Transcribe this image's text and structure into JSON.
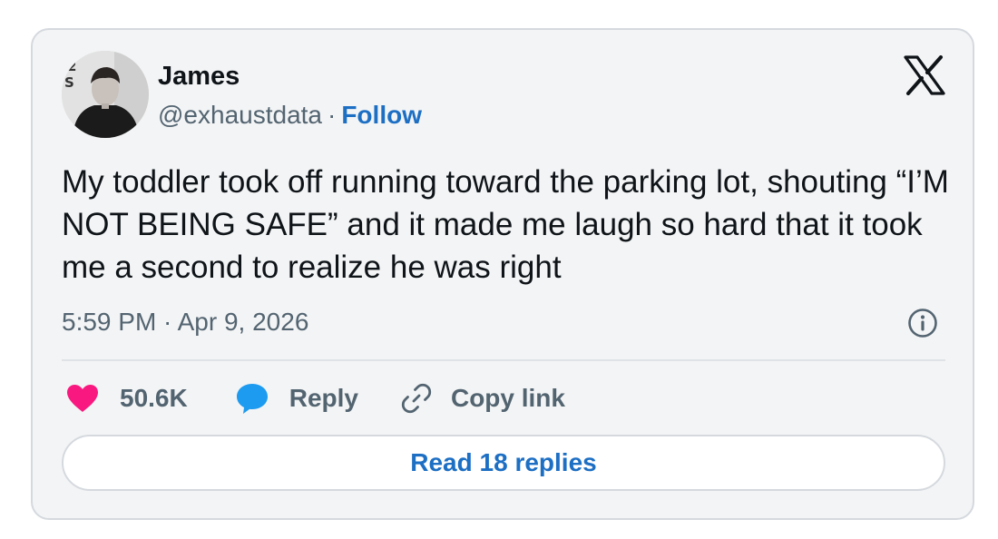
{
  "author": {
    "name": "James",
    "handle": "@exhaustdata",
    "separator": "·",
    "follow_label": "Follow"
  },
  "tweet": {
    "text": "My toddler took off running toward the parking lot, shouting “I’M NOT BEING SAFE” and it made me laugh so hard that it took me a second to realize he was right",
    "timestamp": "5:59 PM · Apr 9, 2026"
  },
  "actions": {
    "likes": "50.6K",
    "reply_label": "Reply",
    "copy_link_label": "Copy link"
  },
  "read_replies_label": "Read 18 replies",
  "icons": {
    "brand": "x-logo-icon",
    "like": "heart-icon",
    "reply": "speech-bubble-icon",
    "copy": "link-icon",
    "info": "info-icon"
  },
  "colors": {
    "like": "#f91880",
    "reply": "#1d9bf0",
    "link": "#1d6fc4",
    "text": "#0f1419",
    "muted": "#536471",
    "card_bg": "#f3f4f5"
  }
}
